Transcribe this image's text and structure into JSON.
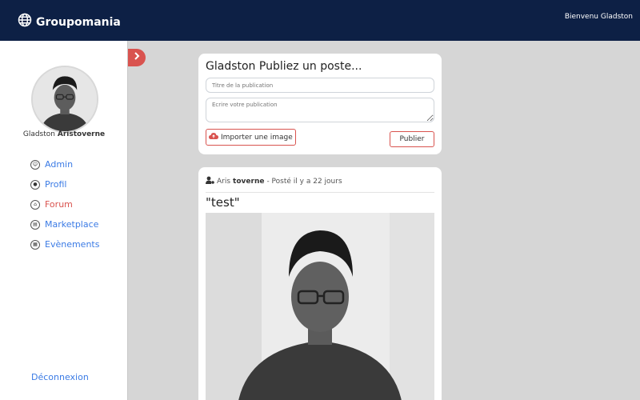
{
  "header": {
    "brand": "Groupomania",
    "brand_icon": "globe-icon",
    "welcome": "Bienvenu Gladston"
  },
  "sidebar": {
    "first_name": "Gladston",
    "last_name": "Aristoverne",
    "items": [
      {
        "label": "Admin",
        "icon": "admin-icon",
        "active": false
      },
      {
        "label": "Profil",
        "icon": "profile-icon",
        "active": false
      },
      {
        "label": "Forum",
        "icon": "home-icon",
        "active": true
      },
      {
        "label": "Marketplace",
        "icon": "store-icon",
        "active": false
      },
      {
        "label": "Evènements",
        "icon": "calendar-icon",
        "active": false
      }
    ],
    "logout": "Déconnexion"
  },
  "compose": {
    "title": "Gladston Publiez un poste...",
    "title_placeholder": "Titre de la publication",
    "body_placeholder": "Ecrire votre publication",
    "import_label": "Importer une image",
    "publish_label": "Publier"
  },
  "post": {
    "author_first": "Aris",
    "author_last": "toverne",
    "posted": "- Posté il y a 22 jours",
    "title": "\"test\""
  },
  "colors": {
    "header_bg": "#0d2045",
    "accent": "#d9534f",
    "link": "#3b7be5",
    "page_bg": "#d6d6d6"
  }
}
